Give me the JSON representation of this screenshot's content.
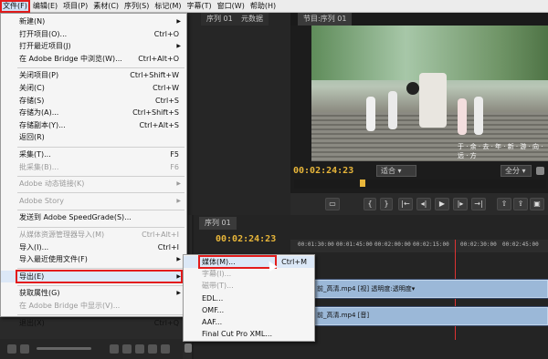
{
  "menubar": {
    "items": [
      {
        "label": "文件(F)",
        "active": true
      },
      {
        "label": "编辑(E)"
      },
      {
        "label": "项目(P)"
      },
      {
        "label": "素材(C)"
      },
      {
        "label": "序列(S)"
      },
      {
        "label": "标记(M)"
      },
      {
        "label": "字幕(T)"
      },
      {
        "label": "窗口(W)"
      },
      {
        "label": "帮助(H)"
      }
    ]
  },
  "source_tabs": {
    "seq": "序列 01",
    "meta": "元数据"
  },
  "program": {
    "tab": "节目:序列 01",
    "timecode": "00:02:24:23",
    "fit": "适合",
    "quality": "全分",
    "caption": "于 · 余 · 去 · 年 · 新 · 游 · 向 · 远 · 方"
  },
  "timeline": {
    "tab": "序列 01",
    "timecode": "00:02:24:23",
    "ruler": [
      "00:01:30:00",
      "00:01:45:00",
      "00:02:00:00",
      "00:02:15:00",
      "00:02:30:00",
      "00:02:45:00"
    ],
    "video_clip": "前_高清.mp4 [视] 透明度:透明度▾",
    "audio_clip": "前_高清.mp4 [音]"
  },
  "file_menu": {
    "items": [
      {
        "label": "新建(N)",
        "shortcut": "",
        "submenu": true
      },
      {
        "label": "打开项目(O)...",
        "shortcut": "Ctrl+O"
      },
      {
        "label": "打开最近项目(J)",
        "shortcut": "",
        "submenu": true
      },
      {
        "label": "在 Adobe Bridge 中浏览(W)...",
        "shortcut": "Ctrl+Alt+O"
      },
      {
        "sep": true
      },
      {
        "label": "关闭项目(P)",
        "shortcut": "Ctrl+Shift+W"
      },
      {
        "label": "关闭(C)",
        "shortcut": "Ctrl+W"
      },
      {
        "label": "存储(S)",
        "shortcut": "Ctrl+S"
      },
      {
        "label": "存储为(A)...",
        "shortcut": "Ctrl+Shift+S"
      },
      {
        "label": "存储副本(Y)...",
        "shortcut": "Ctrl+Alt+S"
      },
      {
        "label": "返回(R)",
        "shortcut": ""
      },
      {
        "sep": true
      },
      {
        "label": "采集(T)...",
        "shortcut": "F5"
      },
      {
        "label": "批采集(B)...",
        "shortcut": "F6",
        "disabled": true
      },
      {
        "sep": true
      },
      {
        "label": "Adobe 动态链接(K)",
        "shortcut": "",
        "submenu": true,
        "disabled": true
      },
      {
        "sep": true
      },
      {
        "label": "Adobe Story",
        "shortcut": "",
        "submenu": true,
        "disabled": true
      },
      {
        "sep": true
      },
      {
        "label": "发送到 Adobe SpeedGrade(S)...",
        "shortcut": ""
      },
      {
        "sep": true
      },
      {
        "label": "从媒体资源管理器导入(M)",
        "shortcut": "Ctrl+Alt+I",
        "disabled": true
      },
      {
        "label": "导入(I)...",
        "shortcut": "Ctrl+I"
      },
      {
        "label": "导入最近使用文件(F)",
        "shortcut": "",
        "submenu": true
      },
      {
        "sep": true
      },
      {
        "label": "导出(E)",
        "shortcut": "",
        "submenu": true,
        "highlight": true
      },
      {
        "sep": true
      },
      {
        "label": "获取属性(G)",
        "shortcut": "",
        "submenu": true
      },
      {
        "label": "在 Adobe Bridge 中显示(V)...",
        "shortcut": "",
        "disabled": true
      },
      {
        "sep": true
      },
      {
        "label": "退出(X)",
        "shortcut": "Ctrl+Q"
      }
    ]
  },
  "export_menu": {
    "items": [
      {
        "label": "媒体(M)...",
        "shortcut": "Ctrl+M",
        "highlight": true
      },
      {
        "label": "字幕(I)...",
        "shortcut": "",
        "disabled": true
      },
      {
        "label": "磁带(T)...",
        "shortcut": "",
        "disabled": true
      },
      {
        "label": "EDL...",
        "shortcut": ""
      },
      {
        "label": "OMF...",
        "shortcut": ""
      },
      {
        "label": "AAF...",
        "shortcut": ""
      },
      {
        "label": "Final Cut Pro XML...",
        "shortcut": ""
      }
    ]
  },
  "colors": {
    "accent_red": "#e31b1b",
    "timecode": "#e8b63a",
    "clip_blue": "#9bb8d8"
  }
}
